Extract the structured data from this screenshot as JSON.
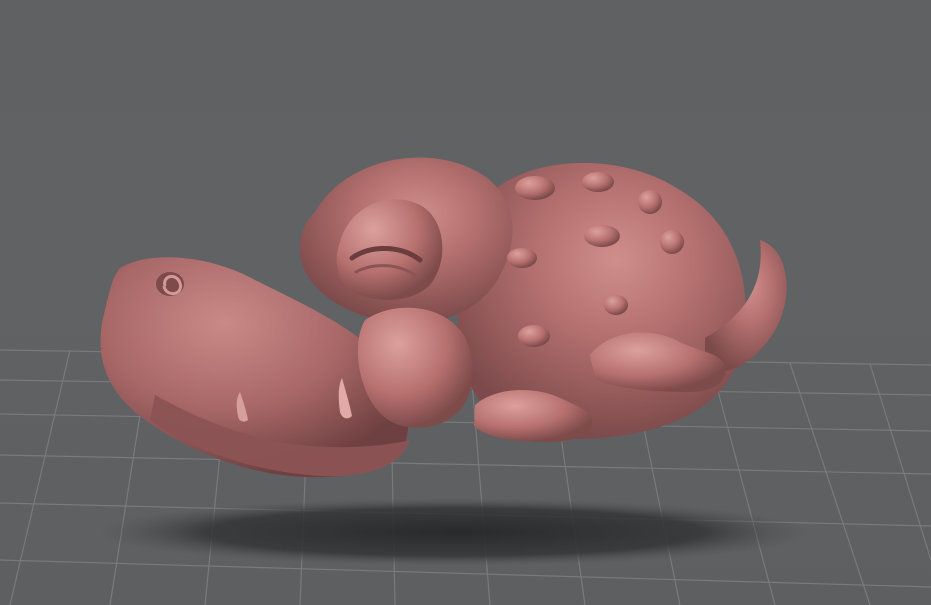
{
  "viewport": {
    "background_color": "#606264",
    "grid_color": "#7b7d80",
    "shadow_color": "#2f3032",
    "material_color": "#b26f6e",
    "subject_icon": "sculpted-creature-head",
    "view_mode": "3d-perspective",
    "grid_visible": true,
    "shadow_visible": true
  }
}
